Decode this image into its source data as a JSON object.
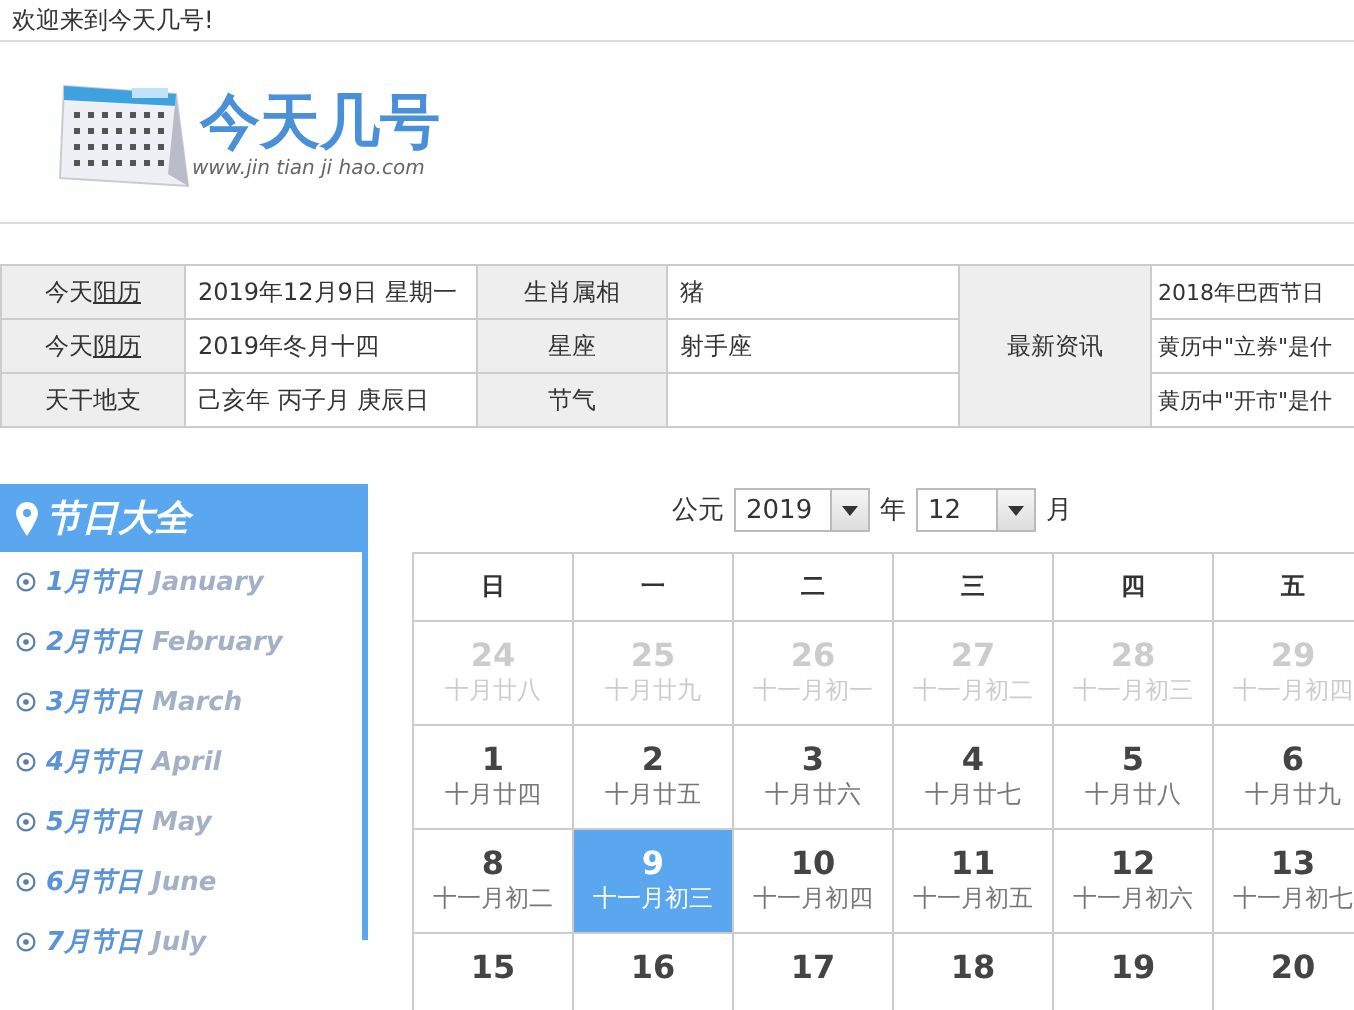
{
  "top_bar": {
    "welcome": "欢迎来到今天几号!"
  },
  "header": {
    "logo_title": "今天几号",
    "logo_url": "www.jin tian ji hao.com"
  },
  "info_table": {
    "rows": [
      {
        "label_prefix": "今天",
        "label_link": "阳历",
        "value": "2019年12月9日 星期一",
        "label2": "生肖属相",
        "value2": "猪",
        "news": "2018年巴西节日"
      },
      {
        "label_prefix": "今天",
        "label_link": "阴历",
        "value": "2019年冬月十四",
        "label2": "星座",
        "value2": "射手座",
        "news": "黄历中\"立券\"是什"
      },
      {
        "label_prefix": "天干地支",
        "label_link": "",
        "value": "己亥年 丙子月 庚辰日",
        "label2": "节气",
        "value2": "",
        "news": "黄历中\"开市\"是什"
      }
    ],
    "news_label": "最新资讯"
  },
  "sidebar": {
    "title": "节日大全",
    "items": [
      {
        "label": "1月节日",
        "english": "January"
      },
      {
        "label": "2月节日",
        "english": "February"
      },
      {
        "label": "3月节日",
        "english": "March"
      },
      {
        "label": "4月节日",
        "english": "April"
      },
      {
        "label": "5月节日",
        "english": "May"
      },
      {
        "label": "6月节日",
        "english": "June"
      },
      {
        "label": "7月节日",
        "english": "July"
      }
    ]
  },
  "calendar": {
    "era_label": "公元",
    "year": "2019",
    "year_label": "年",
    "month": "12",
    "month_label": "月",
    "weekdays": [
      "日",
      "一",
      "二",
      "三",
      "四",
      "五"
    ],
    "weeks": [
      [
        {
          "day": "24",
          "lunar": "十月廿八",
          "other_month": true,
          "selected": false
        },
        {
          "day": "25",
          "lunar": "十月廿九",
          "other_month": true,
          "selected": false
        },
        {
          "day": "26",
          "lunar": "十一月初一",
          "other_month": true,
          "selected": false
        },
        {
          "day": "27",
          "lunar": "十一月初二",
          "other_month": true,
          "selected": false
        },
        {
          "day": "28",
          "lunar": "十一月初三",
          "other_month": true,
          "selected": false
        },
        {
          "day": "29",
          "lunar": "十一月初四",
          "other_month": true,
          "selected": false
        }
      ],
      [
        {
          "day": "1",
          "lunar": "十月廿四",
          "other_month": false,
          "selected": false
        },
        {
          "day": "2",
          "lunar": "十月廿五",
          "other_month": false,
          "selected": false
        },
        {
          "day": "3",
          "lunar": "十月廿六",
          "other_month": false,
          "selected": false
        },
        {
          "day": "4",
          "lunar": "十月廿七",
          "other_month": false,
          "selected": false
        },
        {
          "day": "5",
          "lunar": "十月廿八",
          "other_month": false,
          "selected": false
        },
        {
          "day": "6",
          "lunar": "十月廿九",
          "other_month": false,
          "selected": false
        }
      ],
      [
        {
          "day": "8",
          "lunar": "十一月初二",
          "other_month": false,
          "selected": false
        },
        {
          "day": "9",
          "lunar": "十一月初三",
          "other_month": false,
          "selected": true
        },
        {
          "day": "10",
          "lunar": "十一月初四",
          "other_month": false,
          "selected": false
        },
        {
          "day": "11",
          "lunar": "十一月初五",
          "other_month": false,
          "selected": false
        },
        {
          "day": "12",
          "lunar": "十一月初六",
          "other_month": false,
          "selected": false
        },
        {
          "day": "13",
          "lunar": "十一月初七",
          "other_month": false,
          "selected": false
        }
      ],
      [
        {
          "day": "15",
          "other_month": false,
          "selected": false
        },
        {
          "day": "16",
          "other_month": false,
          "selected": false
        },
        {
          "day": "17",
          "other_month": false,
          "selected": false
        },
        {
          "day": "18",
          "other_month": false,
          "selected": false
        },
        {
          "day": "19",
          "other_month": false,
          "selected": false
        },
        {
          "day": "20",
          "other_month": false,
          "selected": false
        }
      ]
    ]
  }
}
